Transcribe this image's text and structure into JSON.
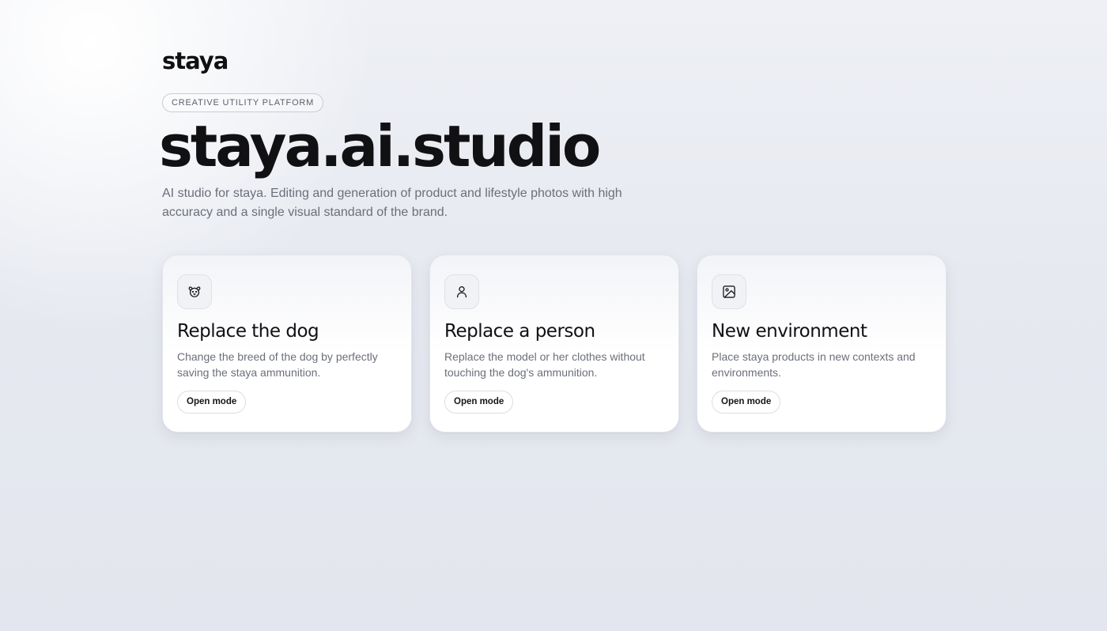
{
  "brand": {
    "logo": "staya"
  },
  "hero": {
    "tag": "CREATIVE UTILITY PLATFORM",
    "title": "staya.ai.studio",
    "description": "AI studio for staya. Editing and generation of product and lifestyle photos with high accuracy and a single visual standard of the brand."
  },
  "cards": [
    {
      "icon": "dog-icon",
      "title": "Replace the dog",
      "description": "Change the breed of the dog by perfectly saving the staya ammunition.",
      "button": "Open mode"
    },
    {
      "icon": "person-icon",
      "title": "Replace a person",
      "description": "Replace the model or her clothes without touching the dog's ammunition.",
      "button": "Open mode"
    },
    {
      "icon": "image-icon",
      "title": "New environment",
      "description": "Place staya products in new contexts and environments.",
      "button": "Open mode"
    }
  ],
  "colors": {
    "text": "#111114",
    "muted": "#6b6f7a",
    "background": "#e6e9f0"
  }
}
